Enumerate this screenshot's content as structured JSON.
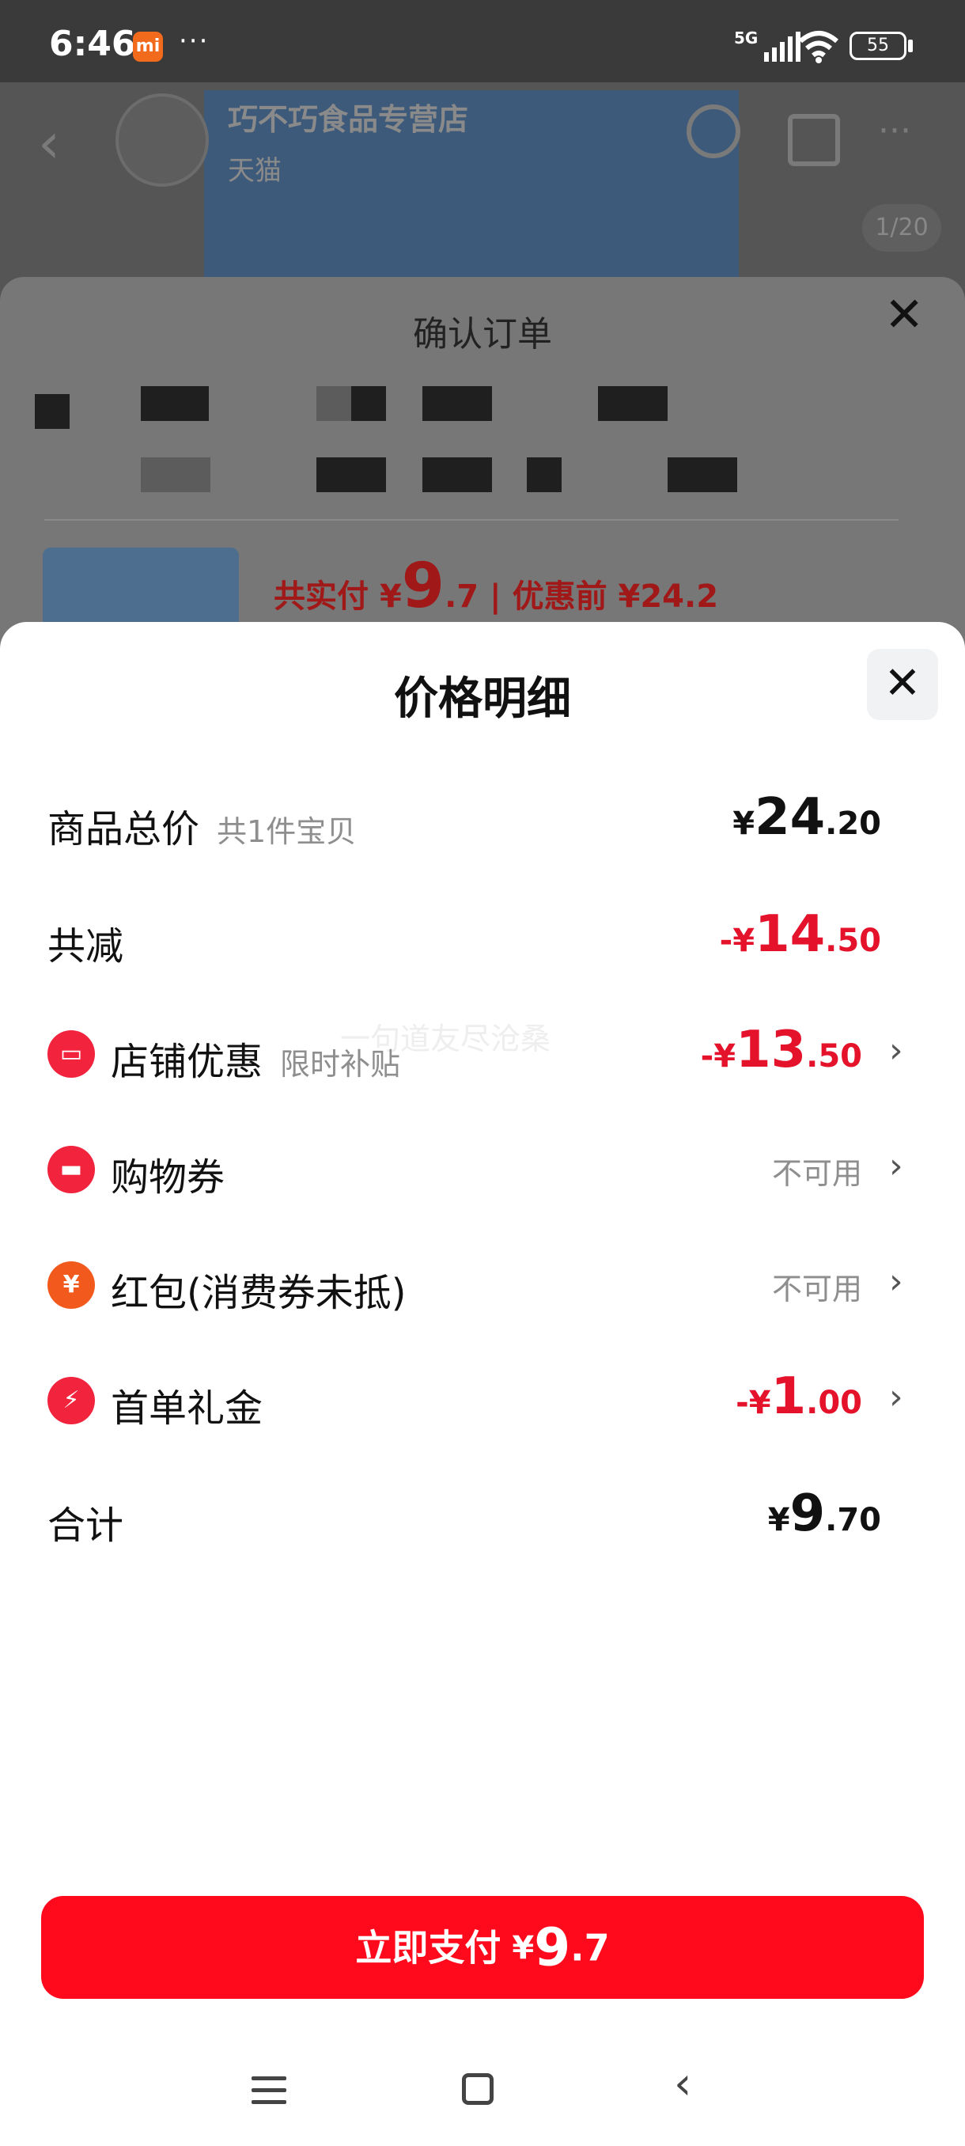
{
  "status_bar": {
    "time": "6:46",
    "mi_badge": "mi",
    "dots": "···",
    "network": "5G",
    "battery": "55"
  },
  "background_page": {
    "shop_name": "巧不巧食品专营店",
    "platform": "天猫",
    "image_counter": "1/20"
  },
  "order_sheet": {
    "title": "确认订单",
    "total_label": "共实付",
    "total_symbol": "¥",
    "total_int": "9",
    "total_dec": ".7",
    "before_label": "| 优惠前",
    "before_value": "¥24.2"
  },
  "price_detail": {
    "title": "价格明细",
    "rows": [
      {
        "label": "商品总价",
        "sub": "共1件宝贝",
        "symbol": "¥",
        "int": "24",
        "dec": ".20",
        "color": "#111111"
      },
      {
        "label": "共减",
        "symbol": "-¥",
        "int": "14",
        "dec": ".50",
        "color": "#e4122a"
      },
      {
        "label": "店铺优惠",
        "sub": "限时补贴",
        "symbol": "-¥",
        "int": "13",
        "dec": ".50",
        "icon": "shop-icon",
        "color": "#e4122a"
      },
      {
        "label": "购物券",
        "value": "不可用",
        "icon": "coupon-icon"
      },
      {
        "label": "红包(消费券未抵)",
        "value": "不可用",
        "icon": "red-packet-icon"
      },
      {
        "label": "首单礼金",
        "symbol": "-¥",
        "int": "1",
        "dec": ".00",
        "icon": "lightning-icon",
        "color": "#e4122a"
      },
      {
        "label": "合计",
        "symbol": "¥",
        "int": "9",
        "dec": ".70",
        "color": "#111111"
      }
    ],
    "watermark": "一句道友尽沧桑"
  },
  "pay_button": {
    "label": "立即支付",
    "symbol": "¥",
    "int": "9",
    "dec": ".7",
    "color": "#ff0a1c"
  }
}
